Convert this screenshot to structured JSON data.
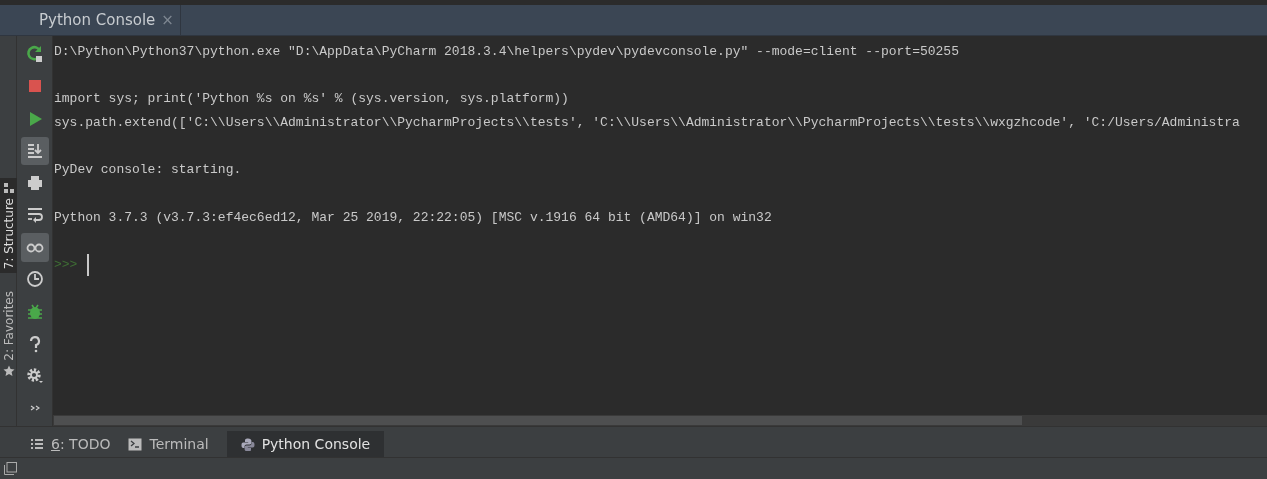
{
  "tool_window": {
    "title": "Python Console",
    "close": "×"
  },
  "side_tabs": [
    {
      "label": "7: Structure",
      "kind": "structure",
      "selected": true
    },
    {
      "label": "2: Favorites",
      "kind": "favorites",
      "selected": false
    }
  ],
  "toolbar": [
    {
      "kind": "rerun",
      "toggled": false
    },
    {
      "kind": "stop",
      "toggled": false
    },
    {
      "kind": "run",
      "toggled": false
    },
    {
      "kind": "scroll-end",
      "toggled": true
    },
    {
      "kind": "print",
      "toggled": false
    },
    {
      "kind": "wrap",
      "toggled": false
    },
    {
      "kind": "glasses",
      "toggled": true
    },
    {
      "kind": "history",
      "toggled": false
    },
    {
      "kind": "debug",
      "toggled": false
    },
    {
      "kind": "help",
      "toggled": false
    },
    {
      "kind": "settings",
      "toggled": false
    },
    {
      "kind": "more",
      "toggled": false
    }
  ],
  "console": {
    "blocks": [
      {
        "lines": [
          "D:\\Python\\Python37\\python.exe \"D:\\AppData\\PyCharm 2018.3.4\\helpers\\pydev\\pydevconsole.py\" --mode=client --port=50255"
        ]
      },
      {
        "lines": [
          "import sys; print('Python %s on %s' % (sys.version, sys.platform))",
          "sys.path.extend(['C:\\\\Users\\\\Administrator\\\\PycharmProjects\\\\tests', 'C:\\\\Users\\\\Administrator\\\\PycharmProjects\\\\tests\\\\wxgzhcode', 'C:/Users/Administra"
        ]
      },
      {
        "lines": [
          "PyDev console: starting."
        ]
      },
      {
        "lines": [
          "Python 3.7.3 (v3.7.3:ef4ec6ed12, Mar 25 2019, 22:22:05) [MSC v.1916 64 bit (AMD64)] on win32"
        ]
      }
    ],
    "prompt": ">>>"
  },
  "bottom_tabs": [
    {
      "kind": "todo",
      "mnemonic": "6",
      "label": ": TODO",
      "selected": false
    },
    {
      "kind": "terminal",
      "label": "Terminal",
      "selected": false
    },
    {
      "kind": "python",
      "label": "Python Console",
      "selected": true
    }
  ]
}
